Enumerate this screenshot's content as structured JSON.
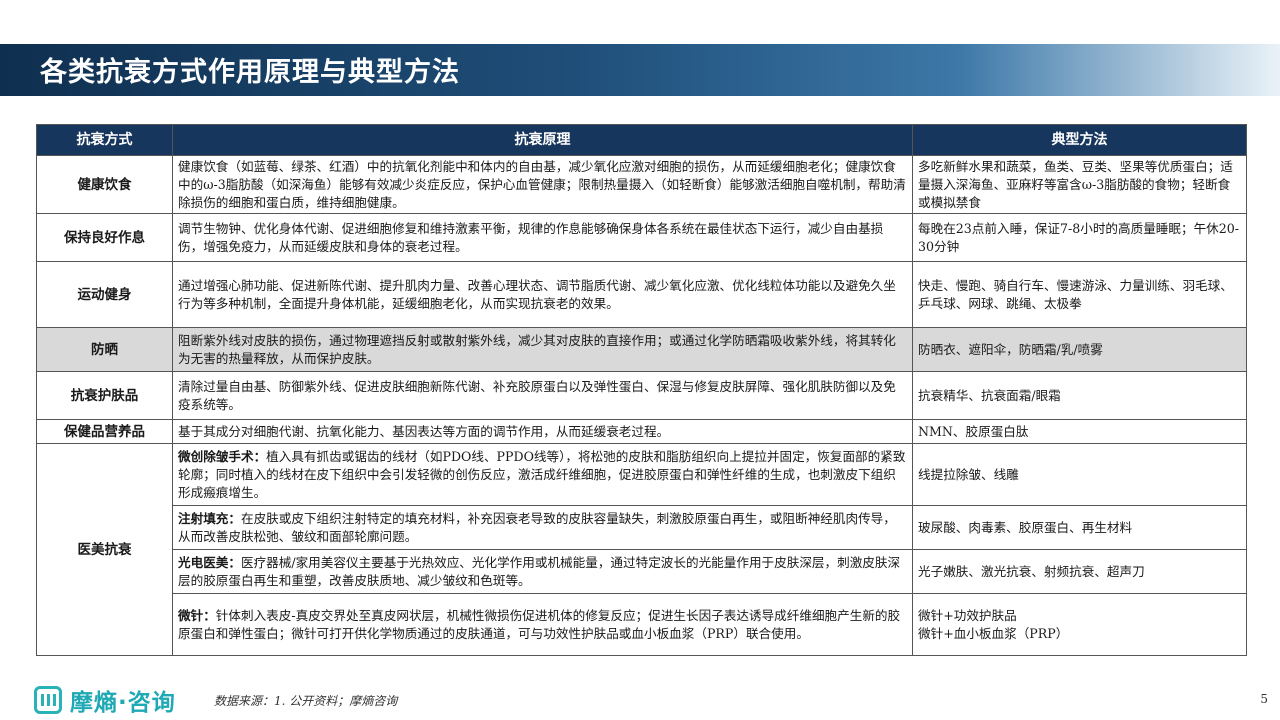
{
  "title": "各类抗衰方式作用原理与典型方法",
  "table": {
    "headers": [
      "抗衰方式",
      "抗衰原理",
      "典型方法"
    ],
    "rows": [
      {
        "method": "健康饮食",
        "principle": "健康饮食（如蓝莓、绿茶、红酒）中的抗氧化剂能中和体内的自由基，减少氧化应激对细胞的损伤，从而延缓细胞老化；健康饮食中的ω-3脂肪酸（如深海鱼）能够有效减少炎症反应，保护心血管健康；限制热量摄入（如轻断食）能够激活细胞自噬机制，帮助清除损伤的细胞和蛋白质，维持细胞健康。",
        "examples": "多吃新鲜水果和蔬菜，鱼类、豆类、坚果等优质蛋白；适量摄入深海鱼、亚麻籽等富含ω-3脂肪酸的食物；轻断食或模拟禁食"
      },
      {
        "method": "保持良好作息",
        "principle": "调节生物钟、优化身体代谢、促进细胞修复和维持激素平衡，规律的作息能够确保身体各系统在最佳状态下运行，减少自由基损伤，增强免疫力，从而延缓皮肤和身体的衰老过程。",
        "examples": "每晚在23点前入睡，保证7-8小时的高质量睡眠；午休20-30分钟"
      },
      {
        "method": "运动健身",
        "principle": "通过增强心肺功能、促进新陈代谢、提升肌肉力量、改善心理状态、调节脂质代谢、减少氧化应激、优化线粒体功能以及避免久坐行为等多种机制，全面提升身体机能，延缓细胞老化，从而实现抗衰老的效果。",
        "examples": "快走、慢跑、骑自行车、慢速游泳、力量训练、羽毛球、乒乓球、网球、跳绳、太极拳"
      },
      {
        "method": "防晒",
        "principle": "阻断紫外线对皮肤的损伤，通过物理遮挡反射或散射紫外线，减少其对皮肤的直接作用；或通过化学防晒霜吸收紫外线，将其转化为无害的热量释放，从而保护皮肤。",
        "examples": "防晒衣、遮阳伞，防晒霜/乳/喷雾"
      },
      {
        "method": "抗衰护肤品",
        "principle": "清除过量自由基、防御紫外线、促进皮肤细胞新陈代谢、补充胶原蛋白以及弹性蛋白、保湿与修复皮肤屏障、强化肌肤防御以及免疫系统等。",
        "examples": "抗衰精华、抗衰面霜/眼霜"
      },
      {
        "method": "保健品营养品",
        "principle": "基于其成分对细胞代谢、抗氧化能力、基因表达等方面的调节作用，从而延缓衰老过程。",
        "examples": "NMN、胶原蛋白肽"
      }
    ],
    "medical": {
      "method": "医美抗衰",
      "items": [
        {
          "label": "微创除皱手术：",
          "text": "植入具有抓齿或锯齿的线材（如PDO线、PPDO线等），将松弛的皮肤和脂肪组织向上提拉并固定，恢复面部的紧致轮廓；同时植入的线材在皮下组织中会引发轻微的创伤反应，激活成纤维细胞，促进胶原蛋白和弹性纤维的生成，也刺激皮下组织形成瘢痕增生。",
          "examples": "线提拉除皱、线雕"
        },
        {
          "label": "注射填充：",
          "text": "在皮肤或皮下组织注射特定的填充材料，补充因衰老导致的皮肤容量缺失，刺激胶原蛋白再生，或阻断神经肌肉传导，从而改善皮肤松弛、皱纹和面部轮廓问题。",
          "examples": "玻尿酸、肉毒素、胶原蛋白、再生材料"
        },
        {
          "label": "光电医美：",
          "text": "医疗器械/家用美容仪主要基于光热效应、光化学作用或机械能量，通过特定波长的光能量作用于皮肤深层，刺激皮肤深层的胶原蛋白再生和重塑，改善皮肤质地、减少皱纹和色斑等。",
          "examples": "光子嫩肤、激光抗衰、射频抗衰、超声刀"
        },
        {
          "label": "微针：",
          "text": "针体刺入表皮-真皮交界处至真皮网状层，机械性微损伤促进机体的修复反应；促进生长因子表达诱导成纤维细胞产生新的胶原蛋白和弹性蛋白；微针可打开供化学物质通过的皮肤通道，可与功效性护肤品或血小板血浆（PRP）联合使用。",
          "examples": "微针+功效护肤品",
          "examples2": "微针+血小板血浆（PRP）"
        }
      ]
    }
  },
  "footer": {
    "logo_text": "摩熵·咨询",
    "source": "数据来源：1. 公开资料；摩熵咨询",
    "page": "5"
  },
  "colors": {
    "header_bg": "#17365d",
    "shaded_row": "#d9d9d9",
    "brand": "#1fa9b4"
  }
}
